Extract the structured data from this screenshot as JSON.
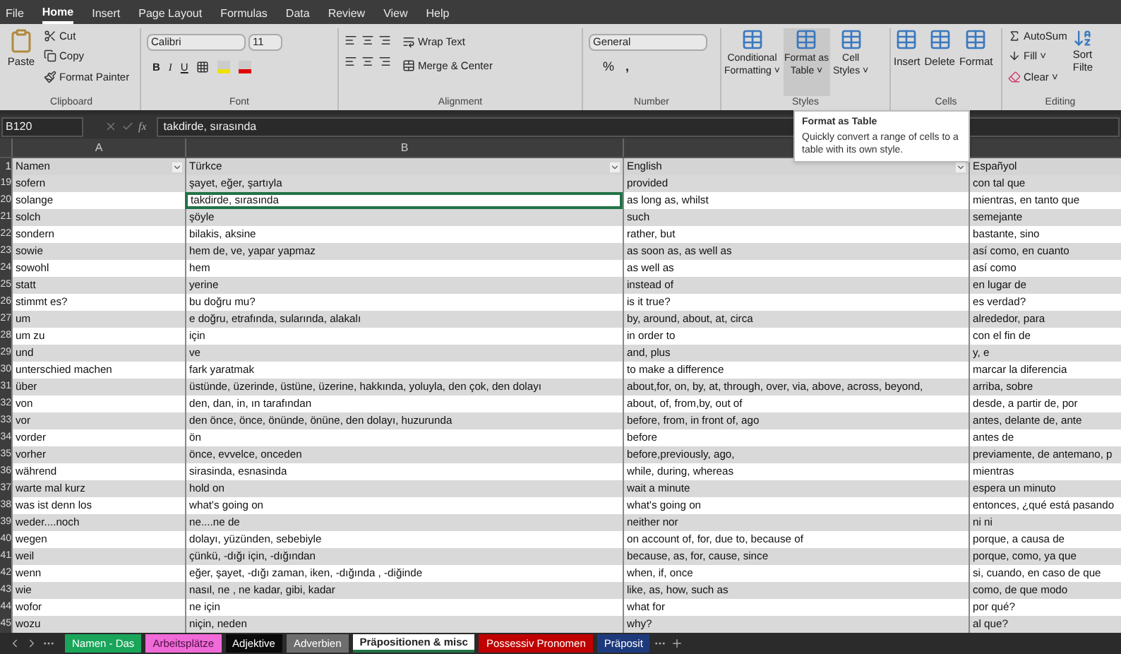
{
  "menu": [
    {
      "label": "File",
      "selected": false
    },
    {
      "label": "Home",
      "selected": true
    },
    {
      "label": "Insert",
      "selected": false
    },
    {
      "label": "Page Layout",
      "selected": false
    },
    {
      "label": "Formulas",
      "selected": false
    },
    {
      "label": "Data",
      "selected": false
    },
    {
      "label": "Review",
      "selected": false
    },
    {
      "label": "View",
      "selected": false
    },
    {
      "label": "Help",
      "selected": false
    }
  ],
  "ribbon": {
    "clipboard": {
      "label": "Clipboard",
      "paste": "Paste",
      "cut": "Cut",
      "copy": "Copy",
      "painter": "Format Painter"
    },
    "font": {
      "label": "Font",
      "font_name": "Calibri",
      "font_size": "11",
      "bold": "B",
      "italic": "I",
      "underline": "U"
    },
    "alignment": {
      "label": "Alignment",
      "wrap": "Wrap Text",
      "merge": "Merge & Center"
    },
    "number": {
      "label": "Number",
      "format": "General",
      "percent": "%",
      "comma": ","
    },
    "styles": {
      "label": "Styles",
      "buttons": [
        {
          "line1": "Conditional",
          "line2": "Formatting ˅",
          "hovered": false
        },
        {
          "line1": "Format as",
          "line2": "Table ˅",
          "hovered": true
        },
        {
          "line1": "Cell",
          "line2": "Styles ˅",
          "hovered": false
        }
      ]
    },
    "cells": {
      "label": "Cells",
      "buttons": [
        "Insert",
        "Delete",
        "Format"
      ]
    },
    "editing": {
      "label": "Editing",
      "autosum": "AutoSum",
      "fill": "Fill ˅",
      "clear": "Clear ˅",
      "sort1": "Sort",
      "sort2": "Filte"
    }
  },
  "formula_bar": {
    "name_box": "B120",
    "fx": "fx",
    "formula": "takdirde, sırasında"
  },
  "column_letters": [
    "A",
    "B"
  ],
  "table": {
    "row_number": "1",
    "columns": [
      "Namen",
      "Türkce",
      "English",
      "Españyol"
    ],
    "rows": [
      {
        "num": "19",
        "cells": [
          "sofern",
          "şayet, eğer, şartıyla",
          "provided",
          "con tal que"
        ],
        "selected": false
      },
      {
        "num": "20",
        "cells": [
          "solange",
          "takdirde, sırasında",
          "as long as, whilst",
          "mientras, en tanto que"
        ],
        "selected": true
      },
      {
        "num": "21",
        "cells": [
          "solch",
          "şöyle",
          "such",
          "semejante"
        ],
        "selected": false
      },
      {
        "num": "22",
        "cells": [
          "sondern",
          "bilakis, aksine",
          "rather, but",
          "bastante, sino"
        ],
        "selected": false
      },
      {
        "num": "23",
        "cells": [
          "sowie",
          "hem de, ve, yapar yapmaz",
          "as soon as, as well as",
          "así como, en cuanto"
        ],
        "selected": false
      },
      {
        "num": "24",
        "cells": [
          "sowohl",
          "hem",
          "as well as",
          "así como"
        ],
        "selected": false
      },
      {
        "num": "25",
        "cells": [
          "statt",
          "yerine",
          "instead of",
          "en lugar de"
        ],
        "selected": false
      },
      {
        "num": "26",
        "cells": [
          "stimmt es?",
          "bu doğru mu?",
          "is it true?",
          "es verdad?"
        ],
        "selected": false
      },
      {
        "num": "27",
        "cells": [
          "um",
          "e doğru, etrafında, sularında, alakalı",
          "by, around, about, at, circa",
          "alrededor, para"
        ],
        "selected": false
      },
      {
        "num": "28",
        "cells": [
          "um zu",
          "için",
          "in order to",
          "con el fin de"
        ],
        "selected": false
      },
      {
        "num": "29",
        "cells": [
          "und",
          "ve",
          "and, plus",
          "y, e"
        ],
        "selected": false
      },
      {
        "num": "30",
        "cells": [
          "unterschied machen",
          "fark yaratmak",
          "to make a difference",
          "marcar la diferencia"
        ],
        "selected": false
      },
      {
        "num": "31",
        "cells": [
          "über",
          "üstünde, üzerinde, üstüne, üzerine, hakkında, yoluyla, den çok, den dolayı",
          "about,for, on, by, at, through, over, via, above, across, beyond,",
          "arriba, sobre"
        ],
        "selected": false
      },
      {
        "num": "32",
        "cells": [
          "von",
          "den, dan, in, ın tarafından",
          "about, of, from,by, out of",
          "desde, a partir de, por"
        ],
        "selected": false
      },
      {
        "num": "33",
        "cells": [
          "vor",
          "den önce, önce, önünde, önüne, den dolayı, huzurunda",
          "before, from, in front of, ago",
          "antes, delante de, ante"
        ],
        "selected": false
      },
      {
        "num": "34",
        "cells": [
          "vorder",
          "ön",
          "before",
          "antes de"
        ],
        "selected": false
      },
      {
        "num": "35",
        "cells": [
          "vorher",
          "önce, evvelce, onceden",
          "before,previously, ago,",
          "previamente, de antemano, p"
        ],
        "selected": false
      },
      {
        "num": "36",
        "cells": [
          "während",
          "sirasinda, esnasinda",
          "while, during, whereas",
          "mientras"
        ],
        "selected": false
      },
      {
        "num": "37",
        "cells": [
          "warte mal kurz",
          "hold on",
          "wait a minute",
          "espera un minuto"
        ],
        "selected": false
      },
      {
        "num": "38",
        "cells": [
          "was ist denn los",
          "what's going on",
          "what's going on",
          "entonces, ¿qué está pasando"
        ],
        "selected": false
      },
      {
        "num": "39",
        "cells": [
          "weder....noch",
          "ne....ne de",
          "neither nor",
          "ni ni"
        ],
        "selected": false
      },
      {
        "num": "40",
        "cells": [
          "wegen",
          "dolayı, yüzünden, sebebiyle",
          "on account of, for, due to, because of",
          "porque, a causa de"
        ],
        "selected": false
      },
      {
        "num": "41",
        "cells": [
          "weil",
          "çünkü, -dığı için, -dığından",
          "because, as, for, cause, since",
          "porque, como, ya que"
        ],
        "selected": false
      },
      {
        "num": "42",
        "cells": [
          "wenn",
          "eğer, şayet, -dığı zaman, iken, -dığında , -diğinde",
          "when, if, once",
          "si, cuando, en caso de que"
        ],
        "selected": false
      },
      {
        "num": "43",
        "cells": [
          "wie",
          "nasıl, ne , ne kadar, gibi, kadar",
          "like, as, how, such as",
          "como, de que modo"
        ],
        "selected": false
      },
      {
        "num": "44",
        "cells": [
          "wofor",
          "ne için",
          "what for",
          "por qué?"
        ],
        "selected": false
      },
      {
        "num": "45",
        "cells": [
          "wozu",
          "niçin, neden",
          "why?",
          "al que?"
        ],
        "selected": false
      }
    ]
  },
  "tooltip": {
    "title": "Format as Table",
    "text": "Quickly convert a range of cells to a table with its own style."
  },
  "sheet_tabs": [
    {
      "label": "Namen - Das",
      "color": "#1aa55a",
      "selected": false
    },
    {
      "label": "Arbeitsplätze",
      "color": "#f06ad8",
      "selected": false
    },
    {
      "label": "Adjektive",
      "color": "#0a0a0a",
      "selected": false
    },
    {
      "label": "Adverbien",
      "color": "#6e6e6e",
      "selected": false
    },
    {
      "label": "Präpositionen & misc",
      "color": "#ffffff",
      "selected": true
    },
    {
      "label": "Possessiv Pronomen",
      "color": "#c00000",
      "selected": false
    },
    {
      "label": "Präposit",
      "color": "#1d3a7c",
      "selected": false
    }
  ]
}
